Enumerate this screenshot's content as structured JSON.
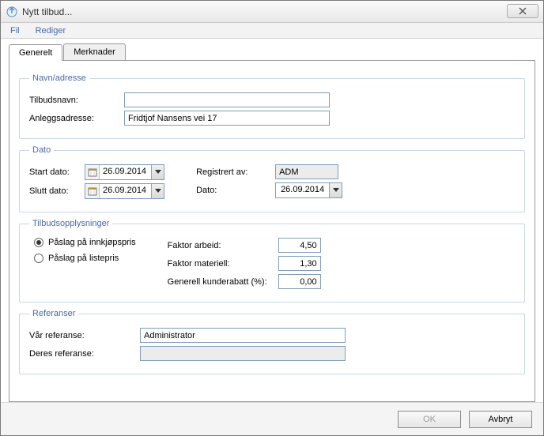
{
  "window": {
    "title": "Nytt tilbud..."
  },
  "menu": {
    "file": "Fil",
    "edit": "Rediger"
  },
  "tabs": {
    "general": "Generelt",
    "notes": "Merknader",
    "active": "general"
  },
  "groups": {
    "nameaddr": {
      "legend": "Navn/adresse",
      "offer_name_label": "Tilbudsnavn:",
      "offer_name_value": "",
      "site_address_label": "Anleggsadresse:",
      "site_address_value": "Fridtjof Nansens vei 17"
    },
    "date": {
      "legend": "Dato",
      "start_label": "Start dato:",
      "start_value": "26.09.2014",
      "end_label": "Slutt dato:",
      "end_value": "26.09.2014",
      "regby_label": "Registrert av:",
      "regby_value": "ADM",
      "date_label": "Dato:",
      "date_value": "26.09.2014"
    },
    "offerinfo": {
      "legend": "Tilbudsopplysninger",
      "radio_cost": "Påslag på innkjøpspris",
      "radio_list": "Påslag på listepris",
      "radio_selected": "cost",
      "factor_labor_label": "Faktor arbeid:",
      "factor_labor_value": "4,50",
      "factor_material_label": "Faktor materiell:",
      "factor_material_value": "1,30",
      "discount_label": "Generell kunderabatt (%):",
      "discount_value": "0,00"
    },
    "refs": {
      "legend": "Referanser",
      "our_ref_label": "Vår referanse:",
      "our_ref_value": "Administrator",
      "their_ref_label": "Deres referanse:",
      "their_ref_value": ""
    }
  },
  "footer": {
    "ok": "OK",
    "cancel": "Avbryt",
    "ok_enabled": false
  }
}
